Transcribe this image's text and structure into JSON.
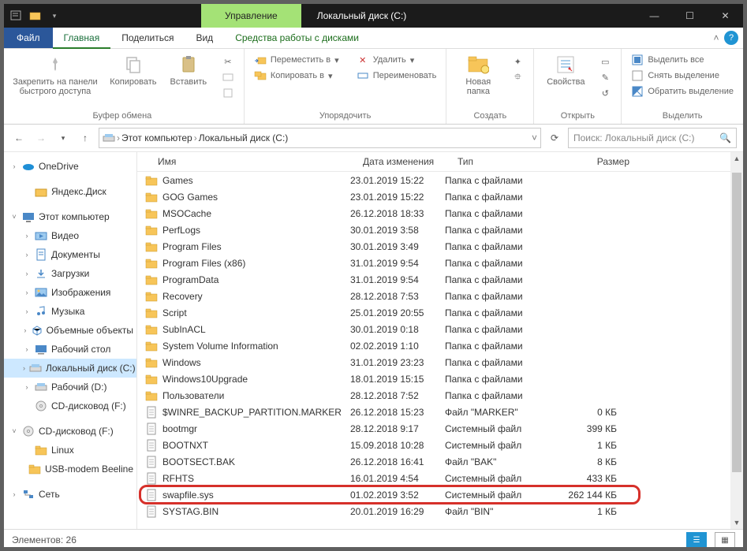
{
  "title": {
    "context_tab": "Управление",
    "text": "Локальный диск (C:)"
  },
  "menu": {
    "file": "Файл",
    "tabs": [
      "Главная",
      "Поделиться",
      "Вид",
      "Средства работы с дисками"
    ]
  },
  "ribbon": {
    "clipboard": {
      "pin": "Закрепить на панели\nбыстрого доступа",
      "copy": "Копировать",
      "paste": "Вставить",
      "group": "Буфер обмена"
    },
    "organize": {
      "move": "Переместить в",
      "copyto": "Копировать в",
      "delete": "Удалить",
      "rename": "Переименовать",
      "group": "Упорядочить"
    },
    "new": {
      "folder": "Новая\nпапка",
      "group": "Создать"
    },
    "open": {
      "properties": "Свойства",
      "group": "Открыть"
    },
    "select": {
      "all": "Выделить все",
      "none": "Снять выделение",
      "invert": "Обратить выделение",
      "group": "Выделить"
    }
  },
  "nav": {
    "path": [
      "Этот компьютер",
      "Локальный диск (C:)"
    ],
    "search_placeholder": "Поиск: Локальный диск (C:)"
  },
  "columns": [
    "Имя",
    "Дата изменения",
    "Тип",
    "Размер"
  ],
  "tree": [
    {
      "exp": ">",
      "icon": "onedrive",
      "label": "OneDrive",
      "indent": 0
    },
    {
      "exp": "",
      "icon": "yadisk",
      "label": "Яндекс.Диск",
      "indent": 1,
      "spacer_before": true
    },
    {
      "exp": "v",
      "icon": "thispc",
      "label": "Этот компьютер",
      "indent": 0,
      "spacer_before": true
    },
    {
      "exp": ">",
      "icon": "video",
      "label": "Видео",
      "indent": 1
    },
    {
      "exp": ">",
      "icon": "docs",
      "label": "Документы",
      "indent": 1
    },
    {
      "exp": ">",
      "icon": "downloads",
      "label": "Загрузки",
      "indent": 1
    },
    {
      "exp": ">",
      "icon": "pictures",
      "label": "Изображения",
      "indent": 1
    },
    {
      "exp": ">",
      "icon": "music",
      "label": "Музыка",
      "indent": 1
    },
    {
      "exp": ">",
      "icon": "3d",
      "label": "Объемные объекты",
      "indent": 1
    },
    {
      "exp": ">",
      "icon": "desktop",
      "label": "Рабочий стол",
      "indent": 1
    },
    {
      "exp": ">",
      "icon": "drive",
      "label": "Локальный диск (C:)",
      "indent": 1,
      "selected": true
    },
    {
      "exp": ">",
      "icon": "drive",
      "label": "Рабочий (D:)",
      "indent": 1
    },
    {
      "exp": "",
      "icon": "cd",
      "label": "CD-дисковод (F:)",
      "indent": 1
    },
    {
      "exp": "v",
      "icon": "cd",
      "label": "CD-дисковод (F:)",
      "indent": 0,
      "spacer_before": true
    },
    {
      "exp": "",
      "icon": "folder",
      "label": "Linux",
      "indent": 1
    },
    {
      "exp": "",
      "icon": "folder",
      "label": "USB-modem Beeline",
      "indent": 1
    },
    {
      "exp": ">",
      "icon": "network",
      "label": "Сеть",
      "indent": 0,
      "spacer_before": true
    }
  ],
  "files": [
    {
      "icon": "folder",
      "name": "Games",
      "date": "23.01.2019 15:22",
      "type": "Папка с файлами",
      "size": ""
    },
    {
      "icon": "folder",
      "name": "GOG Games",
      "date": "23.01.2019 15:22",
      "type": "Папка с файлами",
      "size": ""
    },
    {
      "icon": "folder",
      "name": "MSOCache",
      "date": "26.12.2018 18:33",
      "type": "Папка с файлами",
      "size": ""
    },
    {
      "icon": "folder",
      "name": "PerfLogs",
      "date": "30.01.2019 3:58",
      "type": "Папка с файлами",
      "size": ""
    },
    {
      "icon": "folder",
      "name": "Program Files",
      "date": "30.01.2019 3:49",
      "type": "Папка с файлами",
      "size": ""
    },
    {
      "icon": "folder",
      "name": "Program Files (x86)",
      "date": "31.01.2019 9:54",
      "type": "Папка с файлами",
      "size": ""
    },
    {
      "icon": "folder",
      "name": "ProgramData",
      "date": "31.01.2019 9:54",
      "type": "Папка с файлами",
      "size": ""
    },
    {
      "icon": "folder",
      "name": "Recovery",
      "date": "28.12.2018 7:53",
      "type": "Папка с файлами",
      "size": ""
    },
    {
      "icon": "folder",
      "name": "Script",
      "date": "25.01.2019 20:55",
      "type": "Папка с файлами",
      "size": ""
    },
    {
      "icon": "folder",
      "name": "SubInACL",
      "date": "30.01.2019 0:18",
      "type": "Папка с файлами",
      "size": ""
    },
    {
      "icon": "folder",
      "name": "System Volume Information",
      "date": "02.02.2019 1:10",
      "type": "Папка с файлами",
      "size": ""
    },
    {
      "icon": "folder",
      "name": "Windows",
      "date": "31.01.2019 23:23",
      "type": "Папка с файлами",
      "size": ""
    },
    {
      "icon": "folder",
      "name": "Windows10Upgrade",
      "date": "18.01.2019 15:15",
      "type": "Папка с файлами",
      "size": ""
    },
    {
      "icon": "folder",
      "name": "Пользователи",
      "date": "28.12.2018 7:52",
      "type": "Папка с файлами",
      "size": ""
    },
    {
      "icon": "file",
      "name": "$WINRE_BACKUP_PARTITION.MARKER",
      "date": "26.12.2018 15:23",
      "type": "Файл \"MARKER\"",
      "size": "0 КБ"
    },
    {
      "icon": "file",
      "name": "bootmgr",
      "date": "28.12.2018 9:17",
      "type": "Системный файл",
      "size": "399 КБ"
    },
    {
      "icon": "file",
      "name": "BOOTNXT",
      "date": "15.09.2018 10:28",
      "type": "Системный файл",
      "size": "1 КБ"
    },
    {
      "icon": "file",
      "name": "BOOTSECT.BAK",
      "date": "26.12.2018 16:41",
      "type": "Файл \"BAK\"",
      "size": "8 КБ"
    },
    {
      "icon": "file",
      "name": "RFHTS",
      "date": "16.01.2019 4:54",
      "type": "Системный файл",
      "size": "433 КБ"
    },
    {
      "icon": "file",
      "name": "swapfile.sys",
      "date": "01.02.2019 3:52",
      "type": "Системный файл",
      "size": "262 144 КБ",
      "highlight": true
    },
    {
      "icon": "file",
      "name": "SYSTAG.BIN",
      "date": "20.01.2019 16:29",
      "type": "Файл \"BIN\"",
      "size": "1 КБ"
    }
  ],
  "status": {
    "label": "Элементов:",
    "count": "26"
  },
  "icons": {
    "onedrive": "#1f8fd6",
    "yadisk": "#f7c559",
    "thispc": "#4a88c7",
    "video": "#4a88c7",
    "docs": "#4a88c7",
    "downloads": "#4a88c7",
    "pictures": "#4a88c7",
    "music": "#4a88c7",
    "3d": "#4a88c7",
    "desktop": "#4a88c7",
    "drive": "#9a9a9a",
    "cd": "#9a9a9a",
    "folder": "#f7c559",
    "network": "#4a88c7"
  }
}
